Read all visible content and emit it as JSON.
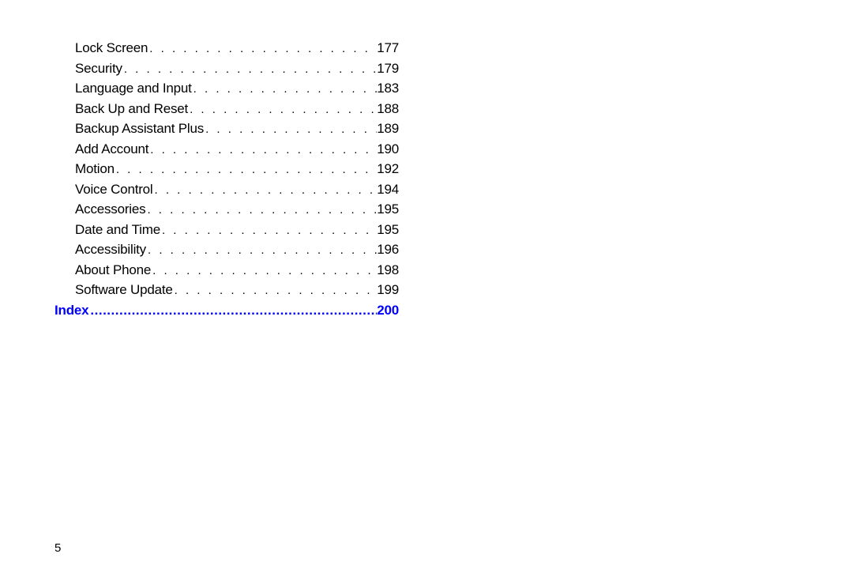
{
  "toc": {
    "entries": [
      {
        "title": "Lock Screen",
        "page": "177"
      },
      {
        "title": "Security",
        "page": "179"
      },
      {
        "title": "Language and Input",
        "page": "183"
      },
      {
        "title": "Back Up and Reset",
        "page": "188"
      },
      {
        "title": "Backup Assistant Plus",
        "page": "189"
      },
      {
        "title": "Add Account",
        "page": "190"
      },
      {
        "title": "Motion",
        "page": "192"
      },
      {
        "title": "Voice Control",
        "page": "194"
      },
      {
        "title": "Accessories",
        "page": "195"
      },
      {
        "title": "Date and Time",
        "page": "195"
      },
      {
        "title": "Accessibility",
        "page": "196"
      },
      {
        "title": "About Phone",
        "page": "198"
      },
      {
        "title": "Software Update",
        "page": "199"
      }
    ],
    "index": {
      "title": "Index",
      "page": "200"
    }
  },
  "page_number": "5",
  "dots_normal": " .  .  .  .  .  .  .  .  .  .  .  .  .  .  .  .  .  .  .  .  .  .  .  .  .  .  .  .  .  .  .  .  .  .  .  .  .  .  .  .  . ",
  "dots_index": " ........................................................................................."
}
